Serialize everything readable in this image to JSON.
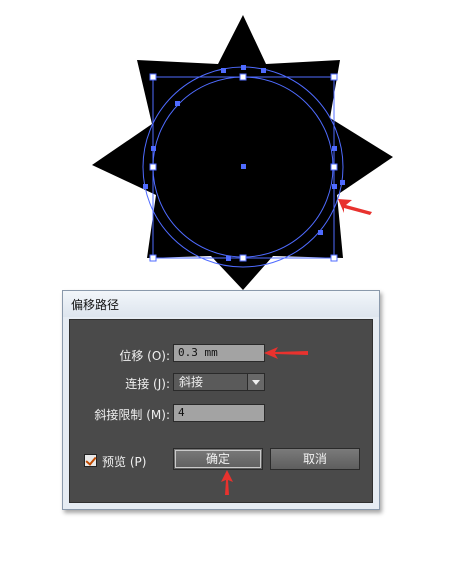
{
  "dialog": {
    "title": "偏移路径",
    "offset": {
      "label": "位移 (O):",
      "value": "0.3 mm"
    },
    "joins": {
      "label": "连接 (J):",
      "value": "斜接"
    },
    "miter_limit": {
      "label": "斜接限制 (M):",
      "value": "4"
    },
    "preview": {
      "label": "预览 (P)",
      "checked": true
    },
    "ok_label": "确定",
    "cancel_label": "取消"
  },
  "colors": {
    "shape_fill": "#000000",
    "path_highlight": "#4f6bff",
    "annotation_arrow": "#e8322e",
    "dialog_body": "#4a4a4a"
  }
}
